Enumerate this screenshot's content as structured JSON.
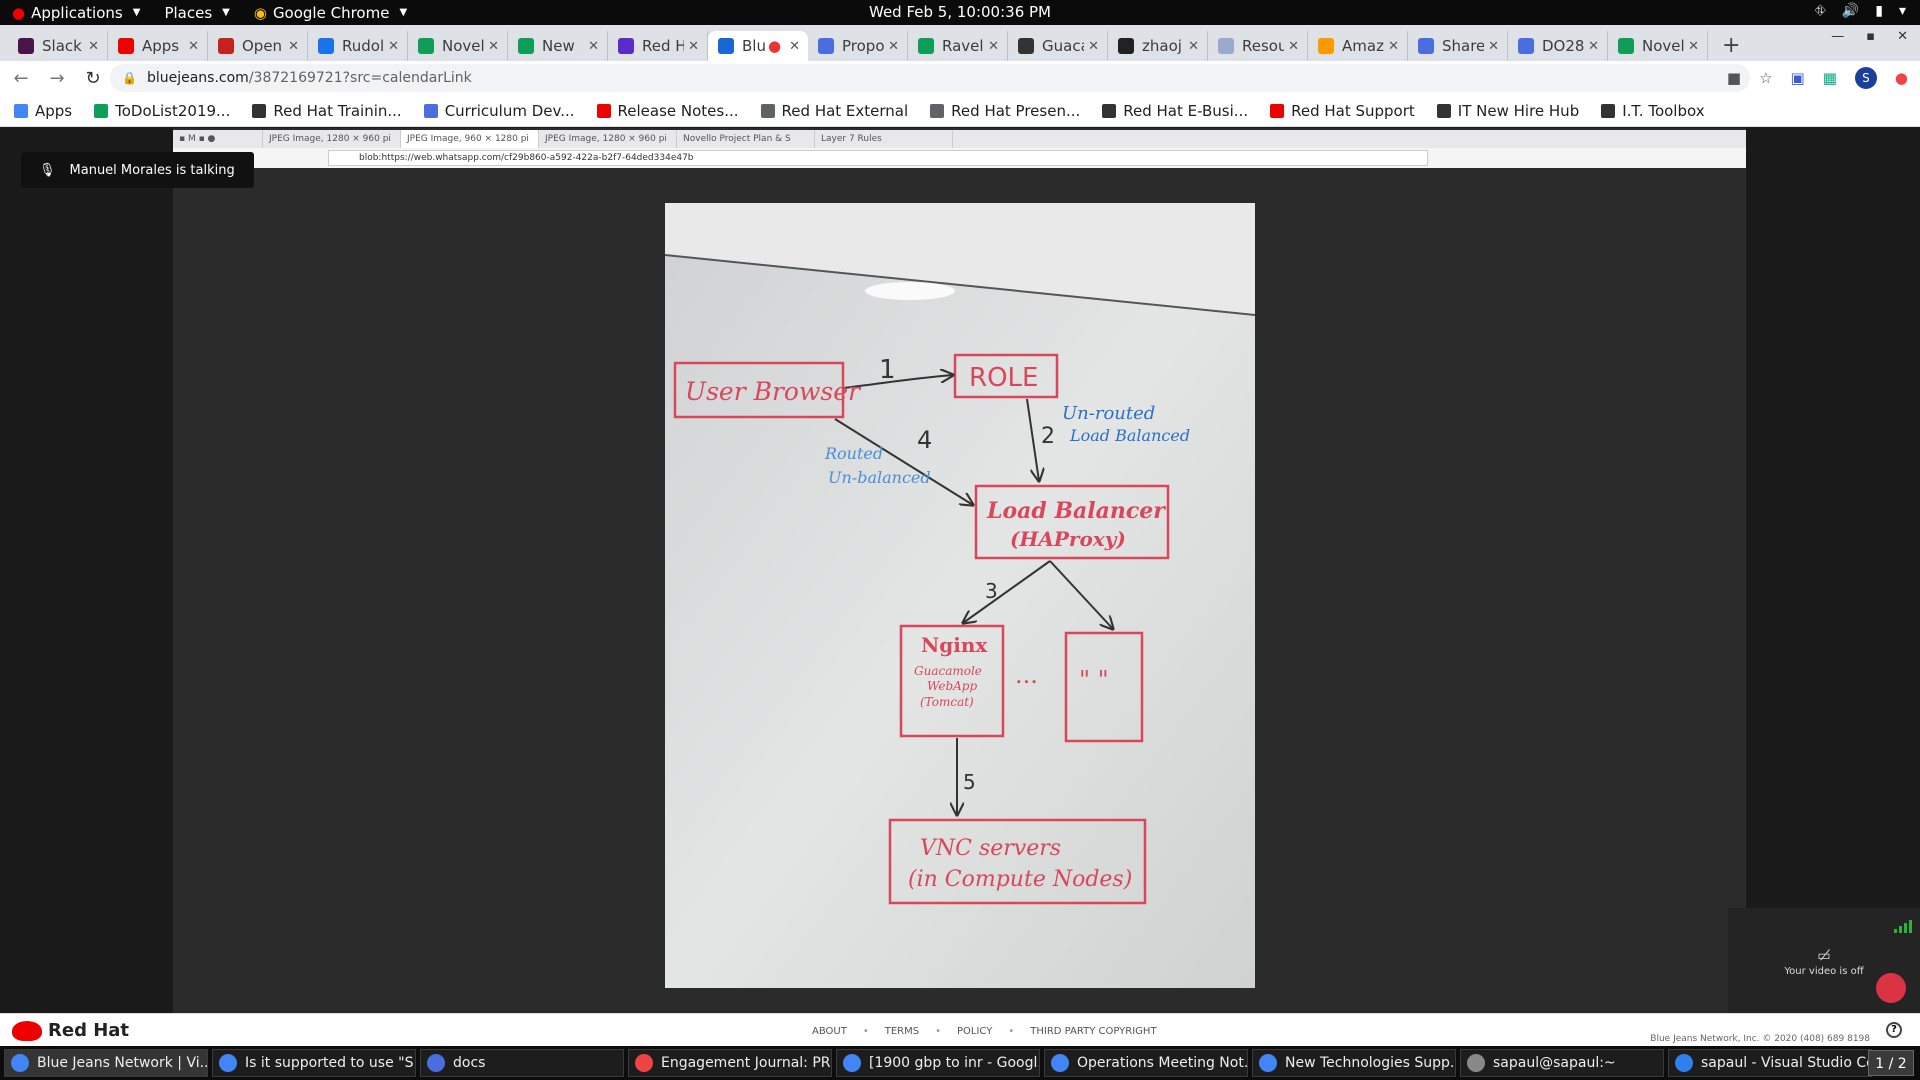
{
  "topbar": {
    "applications": "Applications",
    "places": "Places",
    "browser": "Google Chrome",
    "clock": "Wed Feb  5, 10:00:36 PM"
  },
  "tabs": [
    {
      "label": "Slack",
      "color": "#4a154b"
    },
    {
      "label": "Apps",
      "color": "#e00"
    },
    {
      "label": "Open",
      "color": "#c5221f"
    },
    {
      "label": "Rudol",
      "color": "#1a73e8"
    },
    {
      "label": "Novel",
      "color": "#0f9d58"
    },
    {
      "label": "New",
      "color": "#0f9d58"
    },
    {
      "label": "Red H",
      "color": "#5b2cc9"
    },
    {
      "label": "Blu",
      "color": "#1967d2",
      "active": true
    },
    {
      "label": "Propo",
      "color": "#4a6ee0"
    },
    {
      "label": "Ravell",
      "color": "#0f9d58"
    },
    {
      "label": "Guaca",
      "color": "#333"
    },
    {
      "label": "zhaoj",
      "color": "#222"
    },
    {
      "label": "Resou",
      "color": "#9ac"
    },
    {
      "label": "Amaz",
      "color": "#ff9900"
    },
    {
      "label": "Share",
      "color": "#4a6ee0"
    },
    {
      "label": "DO28",
      "color": "#4a6ee0"
    },
    {
      "label": "Novel",
      "color": "#0f9d58"
    }
  ],
  "url": {
    "host": "bluejeans.com",
    "path": "/387216972​1?src=calendarLink"
  },
  "bookmarks": [
    {
      "label": "Apps",
      "color": "#4285f4"
    },
    {
      "label": "ToDoList2019...",
      "color": "#0f9d58"
    },
    {
      "label": "Red Hat Trainin...",
      "color": "#333"
    },
    {
      "label": "Curriculum Dev...",
      "color": "#4a6ee0"
    },
    {
      "label": "Release Notes...",
      "color": "#e00"
    },
    {
      "label": "Red Hat External",
      "color": "#5f6368"
    },
    {
      "label": "Red Hat Presen...",
      "color": "#5f6368"
    },
    {
      "label": "Red Hat E-Busi...",
      "color": "#333"
    },
    {
      "label": "Red Hat Support",
      "color": "#e00"
    },
    {
      "label": "IT New Hire Hub",
      "color": "#333"
    },
    {
      "label": "I.T. Toolbox",
      "color": "#333"
    }
  ],
  "shared_firefox": {
    "tabs": [
      "JPEG Image, 1280 × 960 pi",
      "JPEG Image, 960 × 1280 pi",
      "JPEG Image, 1280 × 960 pi",
      "Novello Project Plan & S",
      "Layer 7 Rules"
    ],
    "url": "blob:https://web.whatsapp.com/cf29b860-a592-422a-b2f7-64ded334e47b"
  },
  "talking": "Manuel Morales is talking",
  "whiteboard": {
    "user_browser": "User Browser",
    "role": "ROLE",
    "load_balancer": "Load Balancer",
    "haproxy": "(HAProxy)",
    "nginx": "Nginx",
    "nginx_sub1": "Guacamole",
    "nginx_sub2": "WebApp",
    "nginx_sub3": "(Tomcat)",
    "ditto": "\" \"",
    "dots": "...",
    "vnc1": "VNC servers",
    "vnc2": "(in Compute Nodes)",
    "step1": "1",
    "step2": "2",
    "step3": "3",
    "step4": "4",
    "step5": "5",
    "unrouted1": "Un-routed",
    "unrouted2": "Load Balanced",
    "routed1": "Routed",
    "routed2": "Un-balanced"
  },
  "selfview": {
    "text": "Your video is off"
  },
  "footer": {
    "brand": "Red Hat",
    "links": [
      "ABOUT",
      "TERMS",
      "POLICY",
      "THIRD PARTY COPYRIGHT"
    ],
    "copyright": "Blue Jeans Network, Inc. © 2020    (408) 689 8198"
  },
  "taskbar": [
    {
      "label": "Blue Jeans Network | Vi...",
      "color": "#4285f4",
      "active": true
    },
    {
      "label": "Is it supported to use \"S...",
      "color": "#4285f4"
    },
    {
      "label": "docs",
      "color": "#4a6ee0"
    },
    {
      "label": "Engagement Journal: PR...",
      "color": "#e44"
    },
    {
      "label": "[1900 gbp to inr - Googl...",
      "color": "#4285f4"
    },
    {
      "label": "Operations Meeting Not...",
      "color": "#4285f4"
    },
    {
      "label": "New Technologies Supp...",
      "color": "#4285f4"
    },
    {
      "label": "sapaul@sapaul:~",
      "color": "#888"
    },
    {
      "label": "sapaul - Visual Studio Co...",
      "color": "#2f80ed"
    }
  ],
  "pager": "1 / 2"
}
